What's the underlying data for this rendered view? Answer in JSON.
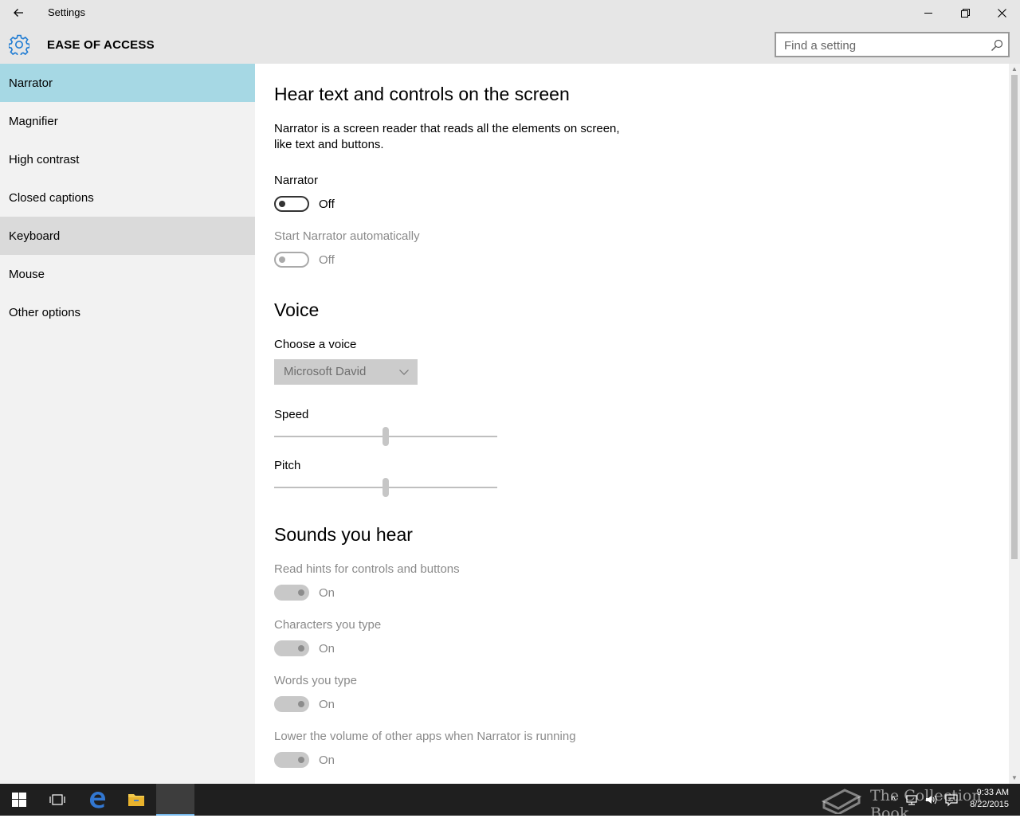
{
  "window": {
    "title": "Settings",
    "back_glyph": "←",
    "minimize_glyph": "—",
    "restore_glyph": "❐",
    "close_glyph": "✕"
  },
  "header": {
    "title": "EASE OF ACCESS",
    "icon": "gear-icon",
    "search_placeholder": "Find a setting"
  },
  "sidebar": {
    "items": [
      {
        "label": "Narrator",
        "state": "selected"
      },
      {
        "label": "Magnifier",
        "state": ""
      },
      {
        "label": "High contrast",
        "state": ""
      },
      {
        "label": "Closed captions",
        "state": ""
      },
      {
        "label": "Keyboard",
        "state": "hover"
      },
      {
        "label": "Mouse",
        "state": ""
      },
      {
        "label": "Other options",
        "state": ""
      }
    ]
  },
  "main": {
    "heading": "Hear text and controls on the screen",
    "description_line1": "Narrator is a screen reader that reads all the elements on screen,",
    "description_line2": "like text and buttons.",
    "narrator": {
      "label": "Narrator",
      "value": "Off"
    },
    "start_auto": {
      "label": "Start Narrator automatically",
      "value": "Off"
    },
    "voice_heading": "Voice",
    "choose_voice": {
      "label": "Choose a voice",
      "value": "Microsoft David"
    },
    "speed": {
      "label": "Speed",
      "level": 0.5
    },
    "pitch": {
      "label": "Pitch",
      "level": 0.5
    },
    "sounds_heading": "Sounds you hear",
    "read_hints": {
      "label": "Read hints for controls and buttons",
      "value": "On"
    },
    "chars_typed": {
      "label": "Characters you type",
      "value": "On"
    },
    "words_typed": {
      "label": "Words you type",
      "value": "On"
    },
    "lower_volume": {
      "label": "Lower the volume of other apps when Narrator is running",
      "value": "On"
    }
  },
  "taskbar": {
    "watermark": "The Collection Book",
    "time": "9:33 AM",
    "date": "8/22/2015"
  },
  "colors": {
    "accent": "#1e7bd3",
    "selected_bg": "#a6d8e4",
    "hover_bg": "#dadada"
  }
}
